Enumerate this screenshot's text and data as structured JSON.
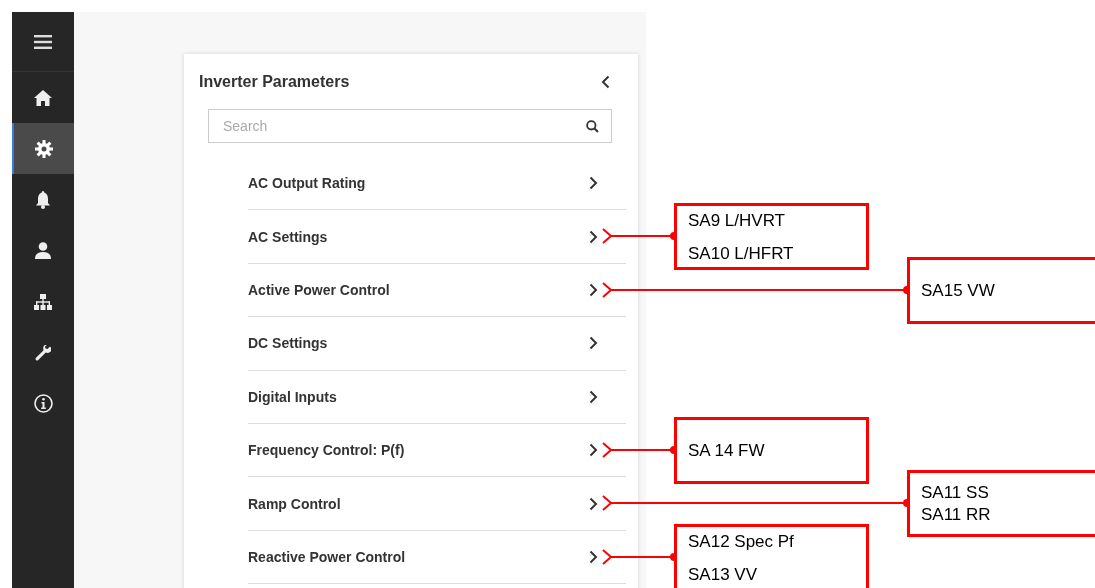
{
  "sidebar": {
    "items": [
      {
        "kind": "menu",
        "selected": false
      },
      {
        "kind": "home",
        "selected": false
      },
      {
        "kind": "settings",
        "selected": true
      },
      {
        "kind": "alerts",
        "selected": false
      },
      {
        "kind": "user",
        "selected": false
      },
      {
        "kind": "network",
        "selected": false
      },
      {
        "kind": "tools",
        "selected": false
      },
      {
        "kind": "info",
        "selected": false
      }
    ]
  },
  "panel": {
    "title": "Inverter Parameters",
    "search": {
      "placeholder": "Search"
    },
    "rows": [
      {
        "label": "AC Output Rating"
      },
      {
        "label": "AC Settings",
        "callout": {
          "lines": [
            "SA9 L/HVRT",
            "SA10 L/HFRT"
          ]
        }
      },
      {
        "label": "Active Power Control",
        "callout": {
          "lines": [
            "SA15 VW"
          ]
        }
      },
      {
        "label": "DC Settings"
      },
      {
        "label": "Digital Inputs"
      },
      {
        "label": "Frequency Control: P(f)",
        "callout": {
          "lines": [
            "SA 14 FW"
          ]
        }
      },
      {
        "label": "Ramp Control",
        "callout": {
          "lines": [
            "SA11 SS",
            "SA11 RR"
          ]
        }
      },
      {
        "label": "Reactive Power Control",
        "callout": {
          "lines": [
            "SA12 Spec Pf",
            "SA13 VV"
          ]
        }
      }
    ]
  }
}
